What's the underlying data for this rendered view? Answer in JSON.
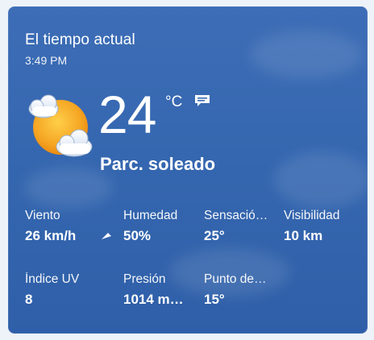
{
  "widget": {
    "title": "El tiempo actual",
    "time": "3:49 PM",
    "temperature": "24",
    "unit": "°C",
    "condition": "Parc. soleado",
    "icons": {
      "weather": "partly-sunny-icon",
      "feedback": "feedback-icon",
      "wind_direction": "wind-direction-arrow-icon"
    },
    "colors": {
      "card_top": "#3d6db6",
      "card_bottom": "#2f5fa8",
      "sun": "#f5a623",
      "text": "#ffffff"
    }
  },
  "metrics": [
    {
      "label": "Viento",
      "value": "26 km/h"
    },
    {
      "label": "Humedad",
      "value": "50%"
    },
    {
      "label": "Sensació…",
      "value": "25°"
    },
    {
      "label": "Visibilidad",
      "value": "10 km"
    },
    {
      "label": "Índice UV",
      "value": "8"
    },
    {
      "label": "Presión",
      "value": "1014 m…"
    },
    {
      "label": "Punto de…",
      "value": "15°"
    }
  ]
}
